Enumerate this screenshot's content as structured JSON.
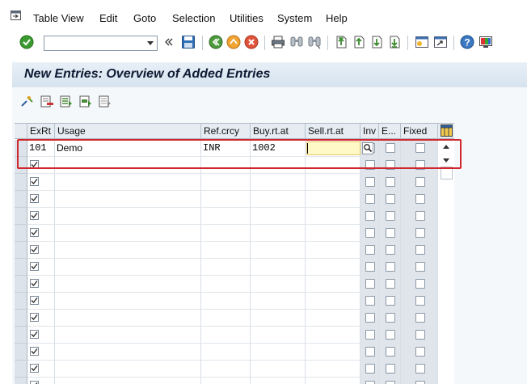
{
  "menu": {
    "items": [
      "Table View",
      "Edit",
      "Goto",
      "Selection",
      "Utilities",
      "System",
      "Help"
    ]
  },
  "toolbar": {
    "command_value": "",
    "icons": [
      "enter-icon",
      "command-field",
      "collapse-icon",
      "save-icon",
      "back-icon",
      "exit-icon",
      "cancel-icon",
      "print-icon",
      "find-icon",
      "find-next-icon",
      "first-page-icon",
      "previous-page-icon",
      "next-page-icon",
      "last-page-icon",
      "create-session-icon",
      "shortcut-icon",
      "help-icon",
      "customize-layout-icon"
    ]
  },
  "title": "New Entries: Overview of Added Entries",
  "app_toolbar": {
    "icons": [
      "change-display-icon",
      "delete-row-icon",
      "select-all-icon",
      "select-block-icon",
      "deselect-all-icon"
    ]
  },
  "table": {
    "columns": [
      "ExRt",
      "Usage",
      "Ref.crcy",
      "Buy.rt.at",
      "Sell.rt.at",
      "Inv",
      "E...",
      "Fixed"
    ],
    "first_row": {
      "exrt": "101",
      "usage": "Demo",
      "refcrcy": "INR",
      "buy": "1002",
      "sell": ""
    },
    "row_count": 15
  },
  "colors": {
    "highlight": "#d0262c",
    "active_input": "#fff8c7",
    "title_bar": "#d6e3ef"
  }
}
